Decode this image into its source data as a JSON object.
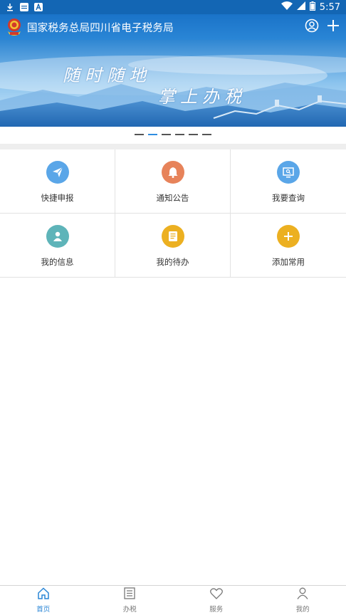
{
  "status_bar": {
    "time": "5:57",
    "left_icons": [
      "download-icon",
      "message-icon",
      "app-a-icon"
    ],
    "right_icons": [
      "wifi-icon",
      "signal-icon",
      "battery-icon"
    ]
  },
  "app_bar": {
    "title": "国家税务总局四川省电子税务局",
    "icons": [
      "emblem-icon",
      "user-icon",
      "add-icon"
    ]
  },
  "banner": {
    "line1": "随时随地",
    "line2": "掌上办税",
    "indicator_count": 6,
    "active_index": 1
  },
  "grid": {
    "items": [
      {
        "label": "快捷申报",
        "icon": "paper-plane-icon",
        "color": "#5aa6e8"
      },
      {
        "label": "通知公告",
        "icon": "bell-icon",
        "color": "#e7835a"
      },
      {
        "label": "我要查询",
        "icon": "monitor-search-icon",
        "color": "#5aa6e8"
      },
      {
        "label": "我的信息",
        "icon": "person-icon",
        "color": "#5eb4b9"
      },
      {
        "label": "我的待办",
        "icon": "document-icon",
        "color": "#ecb021"
      },
      {
        "label": "添加常用",
        "icon": "plus-icon",
        "color": "#ecb021"
      }
    ]
  },
  "bottom_nav": {
    "items": [
      {
        "label": "首页",
        "icon": "home-icon",
        "active": true
      },
      {
        "label": "办税",
        "icon": "list-icon",
        "active": false
      },
      {
        "label": "服务",
        "icon": "heart-icon",
        "active": false
      },
      {
        "label": "我的",
        "icon": "profile-icon",
        "active": false
      }
    ]
  },
  "colors": {
    "primary": "#1a73c8",
    "active_tab": "#2a86d6"
  }
}
